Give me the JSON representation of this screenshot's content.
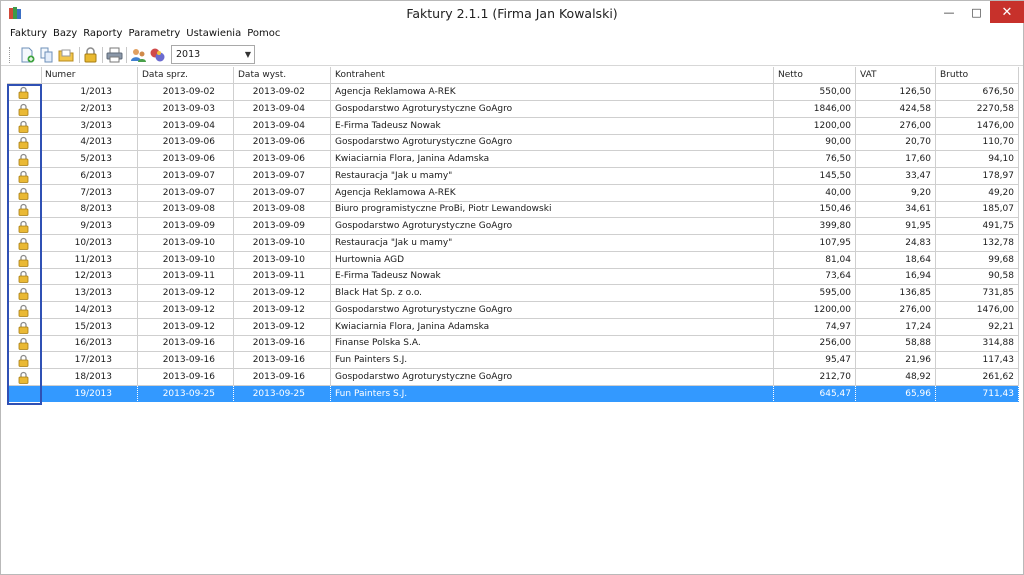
{
  "window": {
    "title": "Faktury 2.1.1 (Firma Jan Kowalski)"
  },
  "menu": [
    {
      "label": "Faktury",
      "name": "menu-faktury"
    },
    {
      "label": "Bazy",
      "name": "menu-bazy"
    },
    {
      "label": "Raporty",
      "name": "menu-raporty"
    },
    {
      "label": "Parametry",
      "name": "menu-parametry"
    },
    {
      "label": "Ustawienia",
      "name": "menu-ustawienia"
    },
    {
      "label": "Pomoc",
      "name": "menu-pomoc"
    }
  ],
  "toolbar": {
    "buttons": [
      "new-document-icon",
      "copy-document-icon",
      "open-folder-icon",
      "lock-icon",
      "print-icon",
      "contacts-icon",
      "database-icon"
    ],
    "year": "2013"
  },
  "table": {
    "columns": {
      "number": "Numer",
      "sale_date": "Data sprz.",
      "issue_date": "Data wyst.",
      "contractor": "Kontrahent",
      "net": "Netto",
      "vat": "VAT",
      "gross": "Brutto"
    },
    "rows": [
      {
        "locked": true,
        "number": "1/2013",
        "sale_date": "2013-09-02",
        "issue_date": "2013-09-02",
        "contractor": "Agencja Reklamowa A-REK",
        "net": "550,00",
        "vat": "126,50",
        "gross": "676,50"
      },
      {
        "locked": true,
        "number": "2/2013",
        "sale_date": "2013-09-03",
        "issue_date": "2013-09-04",
        "contractor": "Gospodarstwo Agroturystyczne GoAgro",
        "net": "1846,00",
        "vat": "424,58",
        "gross": "2270,58"
      },
      {
        "locked": true,
        "number": "3/2013",
        "sale_date": "2013-09-04",
        "issue_date": "2013-09-04",
        "contractor": "E-Firma Tadeusz Nowak",
        "net": "1200,00",
        "vat": "276,00",
        "gross": "1476,00"
      },
      {
        "locked": true,
        "number": "4/2013",
        "sale_date": "2013-09-06",
        "issue_date": "2013-09-06",
        "contractor": "Gospodarstwo Agroturystyczne GoAgro",
        "net": "90,00",
        "vat": "20,70",
        "gross": "110,70"
      },
      {
        "locked": true,
        "number": "5/2013",
        "sale_date": "2013-09-06",
        "issue_date": "2013-09-06",
        "contractor": "Kwiaciarnia Flora, Janina Adamska",
        "net": "76,50",
        "vat": "17,60",
        "gross": "94,10"
      },
      {
        "locked": true,
        "number": "6/2013",
        "sale_date": "2013-09-07",
        "issue_date": "2013-09-07",
        "contractor": "Restauracja \"Jak u mamy\"",
        "net": "145,50",
        "vat": "33,47",
        "gross": "178,97"
      },
      {
        "locked": true,
        "number": "7/2013",
        "sale_date": "2013-09-07",
        "issue_date": "2013-09-07",
        "contractor": "Agencja Reklamowa A-REK",
        "net": "40,00",
        "vat": "9,20",
        "gross": "49,20"
      },
      {
        "locked": true,
        "number": "8/2013",
        "sale_date": "2013-09-08",
        "issue_date": "2013-09-08",
        "contractor": "Biuro programistyczne ProBi, Piotr Lewandowski",
        "net": "150,46",
        "vat": "34,61",
        "gross": "185,07"
      },
      {
        "locked": true,
        "number": "9/2013",
        "sale_date": "2013-09-09",
        "issue_date": "2013-09-09",
        "contractor": "Gospodarstwo Agroturystyczne GoAgro",
        "net": "399,80",
        "vat": "91,95",
        "gross": "491,75"
      },
      {
        "locked": true,
        "number": "10/2013",
        "sale_date": "2013-09-10",
        "issue_date": "2013-09-10",
        "contractor": "Restauracja \"Jak u mamy\"",
        "net": "107,95",
        "vat": "24,83",
        "gross": "132,78"
      },
      {
        "locked": true,
        "number": "11/2013",
        "sale_date": "2013-09-10",
        "issue_date": "2013-09-10",
        "contractor": "Hurtownia AGD",
        "net": "81,04",
        "vat": "18,64",
        "gross": "99,68"
      },
      {
        "locked": true,
        "number": "12/2013",
        "sale_date": "2013-09-11",
        "issue_date": "2013-09-11",
        "contractor": "E-Firma Tadeusz Nowak",
        "net": "73,64",
        "vat": "16,94",
        "gross": "90,58"
      },
      {
        "locked": true,
        "number": "13/2013",
        "sale_date": "2013-09-12",
        "issue_date": "2013-09-12",
        "contractor": "Black Hat Sp. z o.o.",
        "net": "595,00",
        "vat": "136,85",
        "gross": "731,85"
      },
      {
        "locked": true,
        "number": "14/2013",
        "sale_date": "2013-09-12",
        "issue_date": "2013-09-12",
        "contractor": "Gospodarstwo Agroturystyczne GoAgro",
        "net": "1200,00",
        "vat": "276,00",
        "gross": "1476,00"
      },
      {
        "locked": true,
        "number": "15/2013",
        "sale_date": "2013-09-12",
        "issue_date": "2013-09-12",
        "contractor": "Kwiaciarnia Flora, Janina Adamska",
        "net": "74,97",
        "vat": "17,24",
        "gross": "92,21"
      },
      {
        "locked": true,
        "number": "16/2013",
        "sale_date": "2013-09-16",
        "issue_date": "2013-09-16",
        "contractor": "Finanse Polska S.A.",
        "net": "256,00",
        "vat": "58,88",
        "gross": "314,88"
      },
      {
        "locked": true,
        "number": "17/2013",
        "sale_date": "2013-09-16",
        "issue_date": "2013-09-16",
        "contractor": "Fun Painters S.J.",
        "net": "95,47",
        "vat": "21,96",
        "gross": "117,43"
      },
      {
        "locked": true,
        "number": "18/2013",
        "sale_date": "2013-09-16",
        "issue_date": "2013-09-16",
        "contractor": "Gospodarstwo Agroturystyczne GoAgro",
        "net": "212,70",
        "vat": "48,92",
        "gross": "261,62"
      },
      {
        "locked": false,
        "selected": true,
        "number": "19/2013",
        "sale_date": "2013-09-25",
        "issue_date": "2013-09-25",
        "contractor": "Fun Painters S.J.",
        "net": "645,47",
        "vat": "65,96",
        "gross": "711,43"
      }
    ]
  },
  "colors": {
    "selection": "#3399ff",
    "focus_border": "#2f50b4",
    "close_button": "#c7312b"
  }
}
